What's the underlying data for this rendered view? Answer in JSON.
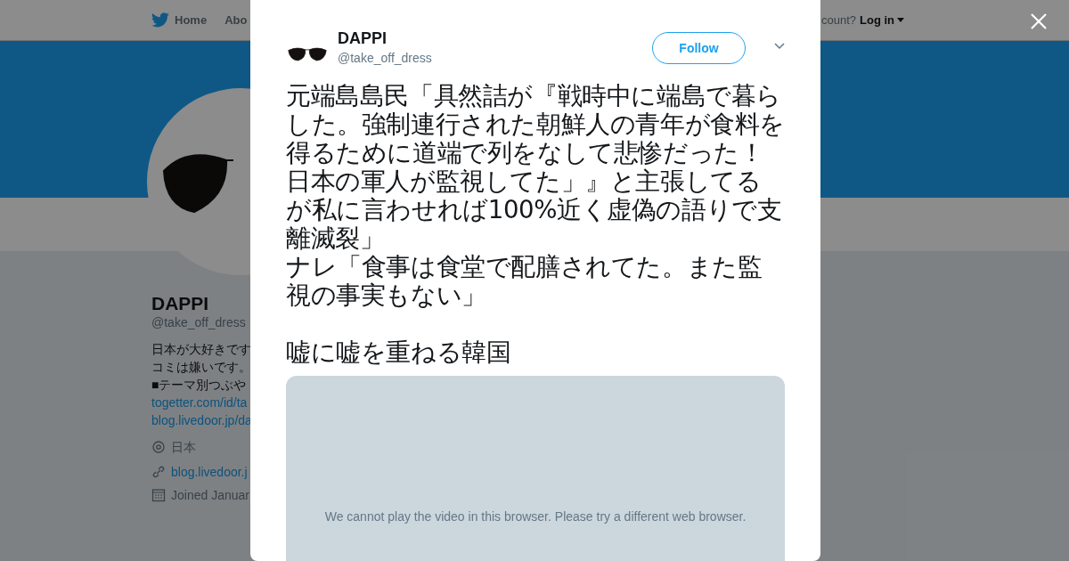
{
  "nav": {
    "home": "Home",
    "about": "Abo",
    "account_prompt": "count?",
    "login": "Log in"
  },
  "profile": {
    "name": "DAPPI",
    "handle": "@take_off_dress",
    "bio": [
      "日本が大好きです",
      "コミは嫌いです。",
      "■テーマ別つぶや"
    ],
    "links": [
      "togetter.com/id/ta",
      "blog.livedoor.jp/da"
    ],
    "location": "日本",
    "website": "blog.livedoor.j",
    "joined": "Joined Januar"
  },
  "tweet": {
    "name": "DAPPI",
    "handle": "@take_off_dress",
    "follow": "Follow",
    "paragraphs": [
      "元端島島民「具然詰が『戦時中に端島で暮らした。強制連行された朝鮮人の青年が食料を得るために道端で列をなして悲惨だった！日本の軍人が監視してた」』と主張してるが私に言わせれば100%近く虚偽の語りで支離滅裂」",
      "ナレ「食事は食堂で配膳されてた。また監視の事実もない」",
      "嘘に嘘を重ねる韓国"
    ],
    "video_message": "We cannot play the video in this browser. Please try a different web browser."
  }
}
